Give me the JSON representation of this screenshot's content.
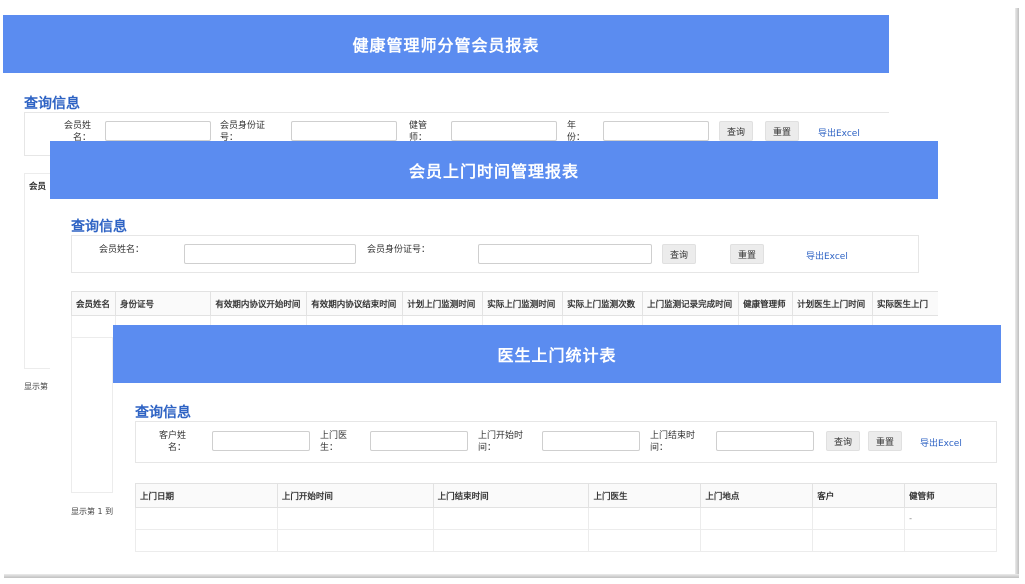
{
  "panel1": {
    "title": "健康管理师分管会员报表",
    "section": "查询信息",
    "fields": [
      "会员姓名：",
      "会员身份证号：",
      "健管师：",
      "年份："
    ],
    "btn_query": "查询",
    "btn_reset": "重置",
    "export": "导出Excel",
    "table_head": "会员",
    "footer": "显示第"
  },
  "panel2": {
    "title": "会员上门时间管理报表",
    "section": "查询信息",
    "fields": [
      "会员姓名：",
      "会员身份证号："
    ],
    "btn_query": "查询",
    "btn_reset": "重置",
    "export": "导出Excel",
    "columns": [
      "会员姓名",
      "身份证号",
      "有效期内协议开始时间",
      "有效期内协议结束时间",
      "计划上门监测时间",
      "实际上门监测时间",
      "实际上门监测次数",
      "上门监测记录完成时间",
      "健康管理师",
      "计划医生上门时间",
      "实际医生上门"
    ],
    "footer": "显示第 1 到"
  },
  "panel3": {
    "title": "医生上门统计表",
    "section": "查询信息",
    "fields": [
      "客户姓名：",
      "上门医生：",
      "上门开始时间：",
      "上门结束时间："
    ],
    "btn_query": "查询",
    "btn_reset": "重置",
    "export": "导出Excel",
    "columns": [
      "上门日期",
      "上门开始时间",
      "上门结束时间",
      "上门医生",
      "上门地点",
      "客户",
      "健管师"
    ],
    "row1_last": "-"
  }
}
